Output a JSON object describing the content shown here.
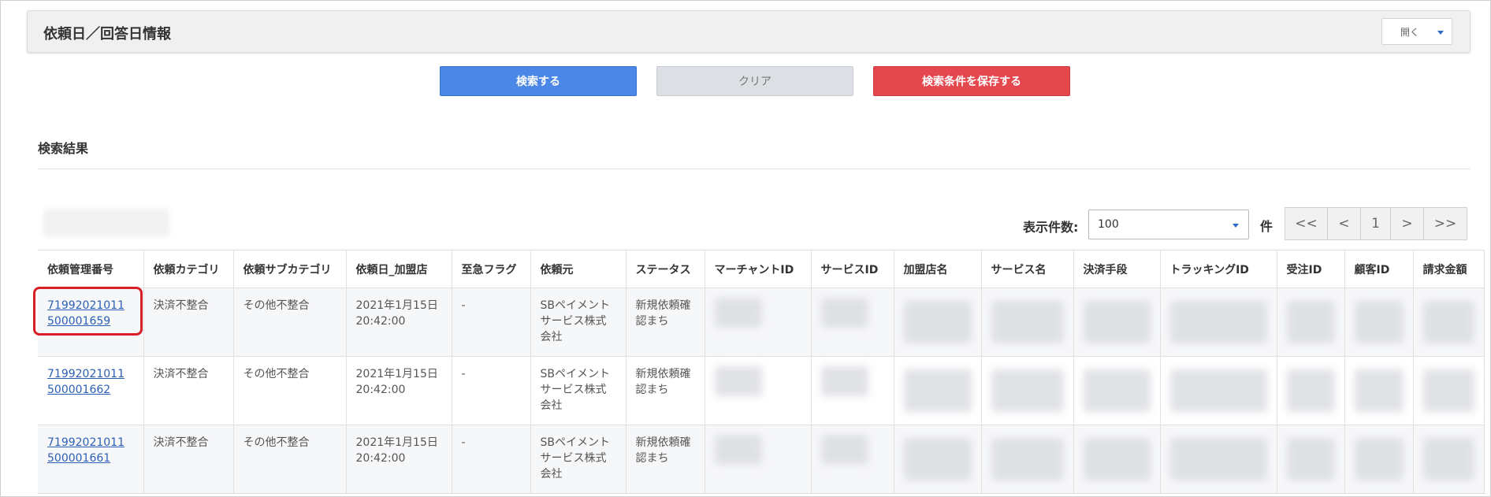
{
  "panel": {
    "title": "依頼日／回答日情報",
    "toggle_label": "開く"
  },
  "actions": {
    "search_label": "検索する",
    "clear_label": "クリア",
    "save_label": "検索条件を保存する"
  },
  "colors": {
    "search_button": "#4a87e6",
    "clear_button": "#dcdfe3",
    "save_button": "#e5474f",
    "link": "#2b5fb5",
    "highlight_border": "#d81f26"
  },
  "results": {
    "title": "検索結果",
    "count_label": "表示件数:",
    "count_value": "100",
    "count_unit": "件",
    "pager": {
      "first": "<<",
      "prev": "<",
      "page": "1",
      "next": ">",
      "last": ">>"
    }
  },
  "table": {
    "headers": [
      "依頼管理番号",
      "依頼カテゴリ",
      "依頼サブカテゴリ",
      "依頼日_加盟店",
      "至急フラグ",
      "依頼元",
      "ステータス",
      "マーチャントID",
      "サービスID",
      "加盟店名",
      "サービス名",
      "決済手段",
      "トラッキングID",
      "受注ID",
      "顧客ID",
      "請求金額"
    ],
    "rows": [
      {
        "id_line1": "71992021011",
        "id_line2": "500001659",
        "category": "決済不整合",
        "subcategory": "その他不整合",
        "date_line1": "2021年1月15日",
        "date_line2": "20:42:00",
        "urgent": "-",
        "source_line1": "SBペイメント",
        "source_line2": "サービス株式",
        "source_line3": "会社",
        "status_line1": "新規依頼確",
        "status_line2": "認まち"
      },
      {
        "id_line1": "71992021011",
        "id_line2": "500001662",
        "category": "決済不整合",
        "subcategory": "その他不整合",
        "date_line1": "2021年1月15日",
        "date_line2": "20:42:00",
        "urgent": "-",
        "source_line1": "SBペイメント",
        "source_line2": "サービス株式",
        "source_line3": "会社",
        "status_line1": "新規依頼確",
        "status_line2": "認まち"
      },
      {
        "id_line1": "71992021011",
        "id_line2": "500001661",
        "category": "決済不整合",
        "subcategory": "その他不整合",
        "date_line1": "2021年1月15日",
        "date_line2": "20:42:00",
        "urgent": "-",
        "source_line1": "SBペイメント",
        "source_line2": "サービス株式",
        "source_line3": "会社",
        "status_line1": "新規依頼確",
        "status_line2": "認まち"
      }
    ]
  }
}
